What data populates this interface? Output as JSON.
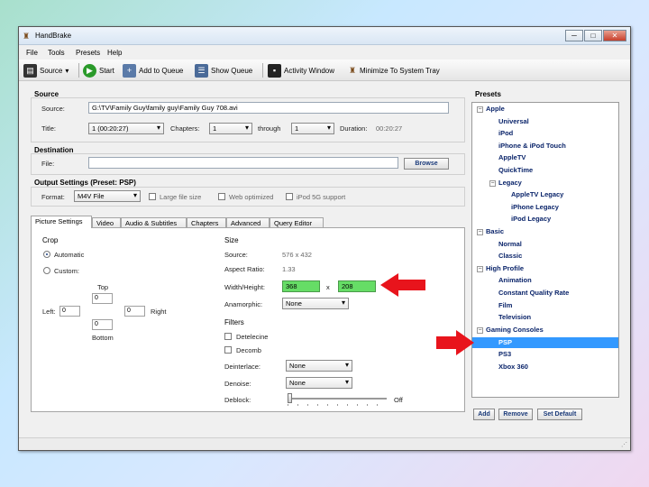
{
  "window": {
    "title": "HandBrake",
    "controls": {
      "minimize": "─",
      "maximize": "□",
      "close": "✕"
    }
  },
  "menu": [
    "File",
    "Tools",
    "Presets",
    "Help"
  ],
  "toolbar": {
    "source": "Source",
    "start": "Start",
    "add_to_queue": "Add to Queue",
    "show_queue": "Show Queue",
    "activity_window": "Activity Window",
    "minimize_tray": "Minimize To System Tray"
  },
  "source_section": {
    "header": "Source",
    "source_label": "Source:",
    "source_value": "G:\\TV\\Family Guy\\family guy\\Family Guy 708.avi",
    "title_label": "Title:",
    "title_value": "1 (00:20:27)",
    "chapters_label": "Chapters:",
    "chapters_start": "1",
    "through_label": "through",
    "chapters_end": "1",
    "duration_label": "Duration:",
    "duration_value": "00:20:27"
  },
  "destination": {
    "header": "Destination",
    "file_label": "File:",
    "file_value": "",
    "browse": "Browse"
  },
  "output": {
    "header": "Output Settings (Preset: PSP)",
    "format_label": "Format:",
    "format_value": "M4V File",
    "large_file": "Large file size",
    "web_optimized": "Web optimized",
    "ipod_5g": "iPod 5G support"
  },
  "tabs": [
    "Picture Settings",
    "Video",
    "Audio & Subtitles",
    "Chapters",
    "Advanced",
    "Query Editor"
  ],
  "crop": {
    "header": "Crop",
    "automatic": "Automatic",
    "custom": "Custom:",
    "top_label": "Top",
    "left_label": "Left:",
    "right_label": "Right",
    "bottom_label": "Bottom",
    "top": "0",
    "left": "0",
    "right": "0",
    "bottom": "0"
  },
  "size": {
    "header": "Size",
    "source_label": "Source:",
    "source_value": "576 x 432",
    "aspect_label": "Aspect Ratio:",
    "aspect_value": "1.33",
    "wh_label": "Width/Height:",
    "width": "368",
    "x": "x",
    "height": "208",
    "anamorphic_label": "Anamorphic:",
    "anamorphic_value": "None"
  },
  "filters": {
    "header": "Filters",
    "detelecine": "Detelecine",
    "decomb": "Decomb",
    "deinterlace_label": "Deinterlace:",
    "deinterlace_value": "None",
    "denoise_label": "Denoise:",
    "denoise_value": "None",
    "deblock_label": "Deblock:",
    "deblock_value": "Off",
    "deblock_level": 0
  },
  "presets": {
    "header": "Presets",
    "items": [
      {
        "label": "Apple",
        "level": 0,
        "toggle": "⊟"
      },
      {
        "label": "Universal",
        "level": 1
      },
      {
        "label": "iPod",
        "level": 1
      },
      {
        "label": "iPhone & iPod Touch",
        "level": 1
      },
      {
        "label": "AppleTV",
        "level": 1
      },
      {
        "label": "QuickTime",
        "level": 1
      },
      {
        "label": "Legacy",
        "level": 1,
        "toggle": "⊟"
      },
      {
        "label": "AppleTV Legacy",
        "level": 2
      },
      {
        "label": "iPhone Legacy",
        "level": 2
      },
      {
        "label": "iPod Legacy",
        "level": 2
      },
      {
        "label": "Basic",
        "level": 0,
        "toggle": "⊟"
      },
      {
        "label": "Normal",
        "level": 1
      },
      {
        "label": "Classic",
        "level": 1
      },
      {
        "label": "High Profile",
        "level": 0,
        "toggle": "⊟"
      },
      {
        "label": "Animation",
        "level": 1
      },
      {
        "label": "Constant Quality Rate",
        "level": 1
      },
      {
        "label": "Film",
        "level": 1
      },
      {
        "label": "Television",
        "level": 1
      },
      {
        "label": "Gaming Consoles",
        "level": 0,
        "toggle": "⊟"
      },
      {
        "label": "PSP",
        "level": 1,
        "selected": true
      },
      {
        "label": "PS3",
        "level": 1
      },
      {
        "label": "Xbox 360",
        "level": 1
      }
    ],
    "add": "Add",
    "remove": "Remove",
    "set_default": "Set Default"
  },
  "colors": {
    "highlight_green": "#66dd66",
    "arrow_red": "#e8141c",
    "selection_blue": "#3399ff"
  }
}
